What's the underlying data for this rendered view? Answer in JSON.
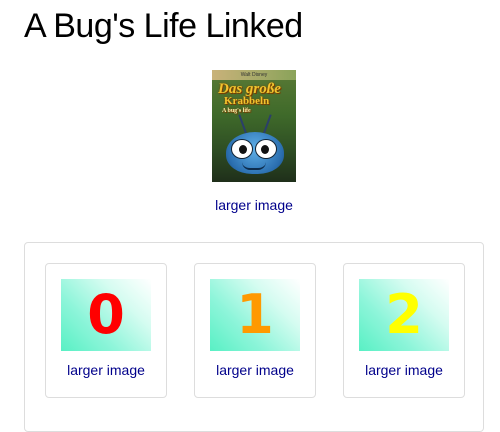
{
  "page": {
    "title": "A Bug's Life Linked"
  },
  "main_image": {
    "poster_top_text": "Walt Disney",
    "poster_title_line1": "Das große",
    "poster_title_line2": "Krabbeln",
    "poster_title_line3": "A bug's life",
    "link_text": "larger image"
  },
  "gallery": {
    "items": [
      {
        "digit": "0",
        "color": "#ff0000",
        "link_text": "larger image"
      },
      {
        "digit": "1",
        "color": "#ff9900",
        "link_text": "larger image"
      },
      {
        "digit": "2",
        "color": "#ffff00",
        "link_text": "larger image"
      }
    ]
  },
  "colors": {
    "link": "#00008b",
    "thumbnail_gradient_start": "#58f0c4",
    "border": "#dddddd"
  }
}
